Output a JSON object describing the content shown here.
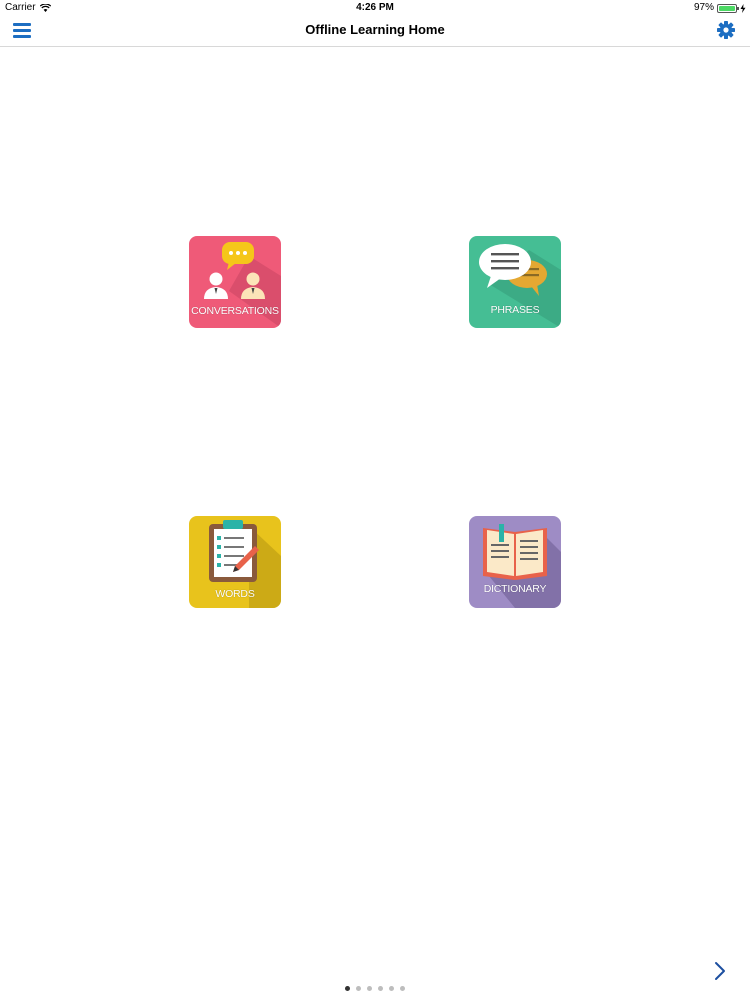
{
  "status_bar": {
    "carrier": "Carrier",
    "time": "4:26 PM",
    "battery": "97%",
    "battery_level": 0.97
  },
  "nav": {
    "title": "Offline Learning Home",
    "menu_icon": "hamburger-icon",
    "settings_icon": "gear-icon"
  },
  "tiles": [
    {
      "label": "CONVERSATIONS",
      "icon": "conversation-people-icon",
      "color": "#ef5a78"
    },
    {
      "label": "PHRASES",
      "icon": "speech-bubbles-icon",
      "color": "#45be94"
    },
    {
      "label": "WORDS",
      "icon": "clipboard-checklist-icon",
      "color": "#e8c31c"
    },
    {
      "label": "DICTIONARY",
      "icon": "open-book-icon",
      "color": "#9e8cc5"
    }
  ],
  "pager": {
    "pages": 6,
    "current": 1,
    "next_icon": "chevron-right-icon"
  },
  "colors": {
    "accent": "#1d6ec2"
  }
}
